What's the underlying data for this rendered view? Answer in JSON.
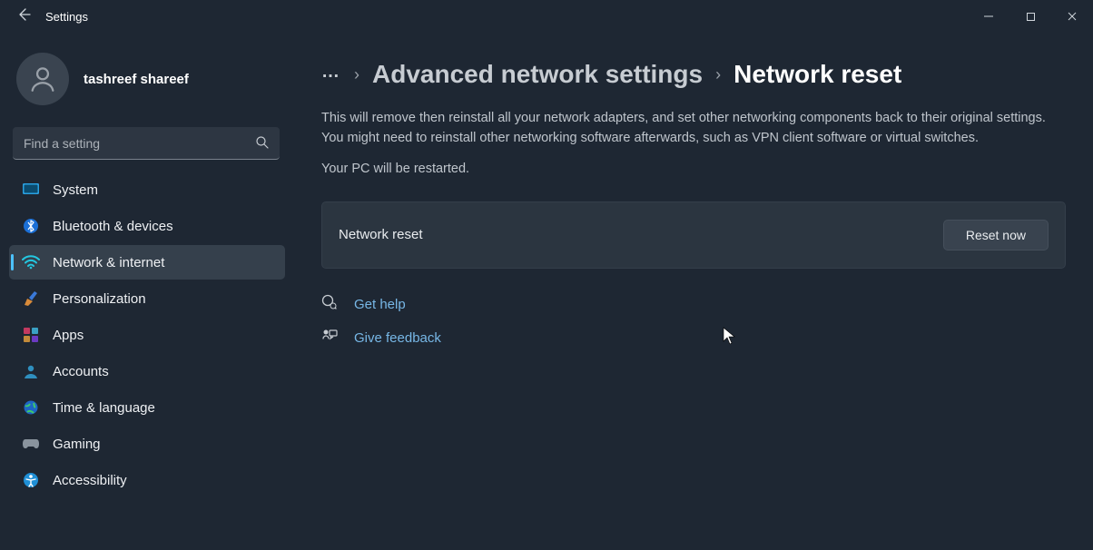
{
  "window": {
    "title": "Settings"
  },
  "user": {
    "name": "tashreef shareef"
  },
  "search": {
    "placeholder": "Find a setting"
  },
  "sidebar": {
    "items": [
      {
        "label": "System",
        "icon": "system",
        "active": false
      },
      {
        "label": "Bluetooth & devices",
        "icon": "bluetooth",
        "active": false
      },
      {
        "label": "Network & internet",
        "icon": "network",
        "active": true
      },
      {
        "label": "Personalization",
        "icon": "personalize",
        "active": false
      },
      {
        "label": "Apps",
        "icon": "apps",
        "active": false
      },
      {
        "label": "Accounts",
        "icon": "accounts",
        "active": false
      },
      {
        "label": "Time & language",
        "icon": "time",
        "active": false
      },
      {
        "label": "Gaming",
        "icon": "gaming",
        "active": false
      },
      {
        "label": "Accessibility",
        "icon": "accessibility",
        "active": false
      }
    ]
  },
  "breadcrumb": {
    "more": "…",
    "previous": "Advanced network settings",
    "current": "Network reset"
  },
  "main": {
    "description": "This will remove then reinstall all your network adapters, and set other networking components back to their original settings. You might need to reinstall other networking software afterwards, such as VPN client software or virtual switches.",
    "restart_note": "Your PC will be restarted.",
    "card_label": "Network reset",
    "reset_button": "Reset now",
    "help_label": "Get help",
    "feedback_label": "Give feedback"
  }
}
